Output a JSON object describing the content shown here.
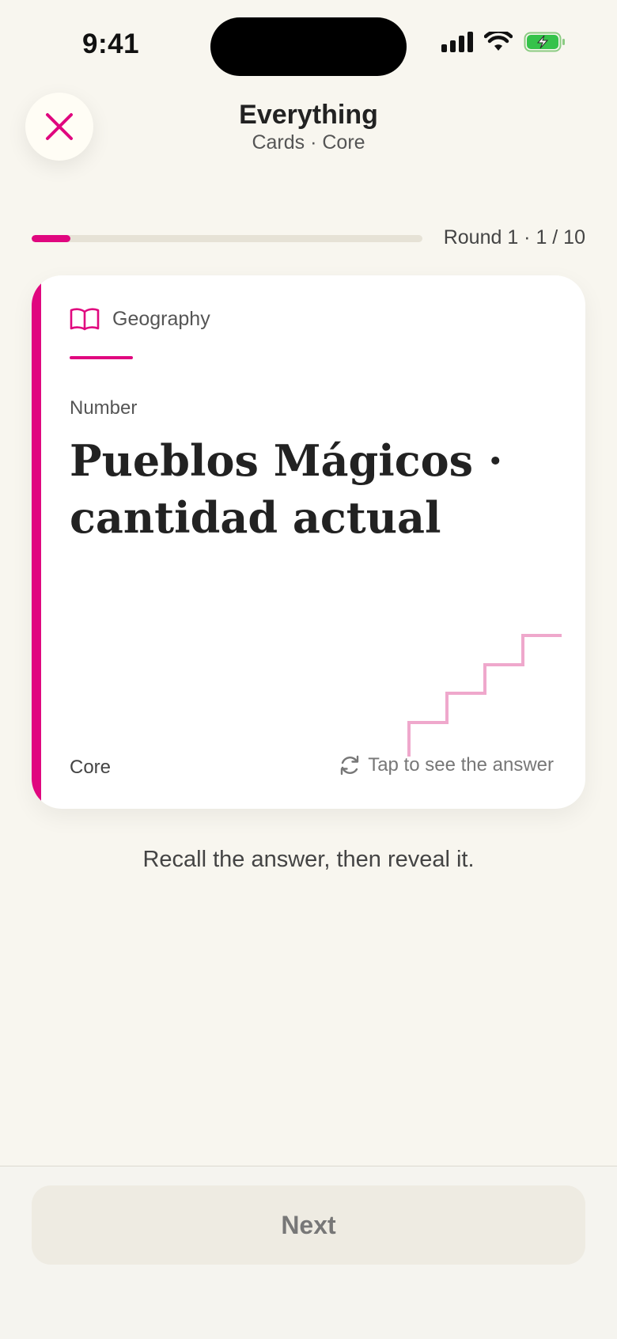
{
  "status_bar": {
    "time": "9:41",
    "icons": [
      "cellular-signal-icon",
      "wifi-icon",
      "battery-charging-icon"
    ]
  },
  "header": {
    "title": "Everything",
    "subtitle": "Cards · Core",
    "close_icon": "close-icon"
  },
  "progress": {
    "label": "Round 1 · 1 / 10",
    "fraction": 0.1
  },
  "card": {
    "topic_icon": "book-icon",
    "topic": "Geography",
    "type": "Number",
    "question": "Pueblos Mágicos · cantidad actual",
    "level": "Core",
    "hint_icon": "refresh-icon",
    "hint": "Tap to see the answer",
    "illustration": "stairs-icon"
  },
  "instruction": "Recall the answer, then reveal it.",
  "footer": {
    "next_label": "Next"
  },
  "colors": {
    "accent": "#E0077F",
    "background": "#F8F6EF",
    "card": "#FFFFFF",
    "illustration": "#EFA8CC"
  }
}
